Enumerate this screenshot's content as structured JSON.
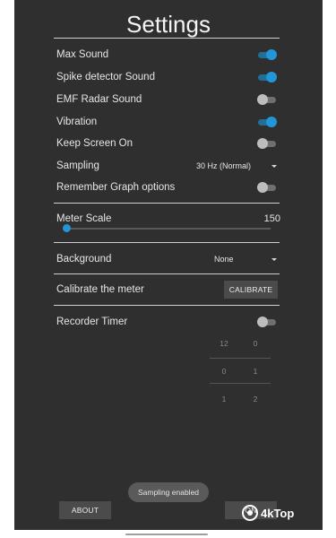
{
  "header": {
    "title": "Settings"
  },
  "toggles": [
    {
      "label": "Max Sound",
      "on": true
    },
    {
      "label": "Spike detector Sound",
      "on": true
    },
    {
      "label": "EMF Radar Sound",
      "on": false
    },
    {
      "label": "Vibration",
      "on": true
    },
    {
      "label": "Keep Screen On",
      "on": false
    }
  ],
  "sampling": {
    "label": "Sampling",
    "value": "30 Hz (Normal)"
  },
  "remember_graph": {
    "label": "Remember Graph options",
    "on": false
  },
  "meter_scale": {
    "label": "Meter Scale",
    "value": "150",
    "slider_fraction": 0.0
  },
  "background": {
    "label": "Background",
    "value": "None"
  },
  "calibrate": {
    "label": "Calibrate the meter",
    "button": "CALIBRATE"
  },
  "recorder_timer": {
    "label": "Recorder Timer",
    "on": false,
    "picker": {
      "col1": [
        "12",
        "0",
        "1"
      ],
      "col2": [
        "0",
        "1",
        "2"
      ]
    }
  },
  "toast": "Sampling enabled",
  "footer": {
    "about": "ABOUT",
    "ok": "ON"
  },
  "watermark": "4kTop",
  "colors": {
    "accent": "#2196d8",
    "background": "#2f2f2f"
  }
}
